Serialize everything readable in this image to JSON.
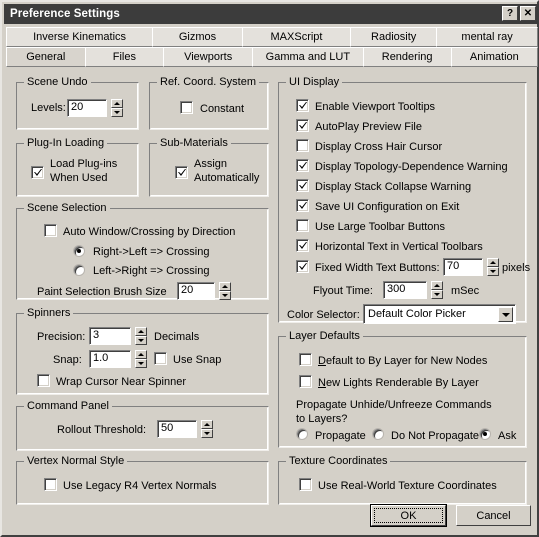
{
  "window": {
    "title": "Preference Settings",
    "help_button": "?",
    "close_button": "✕"
  },
  "tabs": {
    "top_row": [
      {
        "label": "Inverse Kinematics",
        "active": false
      },
      {
        "label": "Gizmos",
        "active": false
      },
      {
        "label": "MAXScript",
        "active": false
      },
      {
        "label": "Radiosity",
        "active": false
      },
      {
        "label": "mental ray",
        "active": false
      }
    ],
    "bottom_row": [
      {
        "label": "General",
        "active": true
      },
      {
        "label": "Files",
        "active": false
      },
      {
        "label": "Viewports",
        "active": false
      },
      {
        "label": "Gamma and LUT",
        "active": false
      },
      {
        "label": "Rendering",
        "active": false
      },
      {
        "label": "Animation",
        "active": false
      }
    ]
  },
  "scene_undo": {
    "title": "Scene Undo",
    "levels_label": "Levels:",
    "levels_value": "20"
  },
  "ref_coord_system": {
    "title": "Ref. Coord. System",
    "constant_label": "Constant",
    "constant_checked": false
  },
  "plugin_loading": {
    "title": "Plug-In Loading",
    "load_label_line1": "Load Plug-ins",
    "load_label_line2": "When Used",
    "load_checked": true
  },
  "sub_materials": {
    "title": "Sub-Materials",
    "assign_label_line1": "Assign",
    "assign_label_line2": "Automatically",
    "assign_checked": true
  },
  "scene_selection": {
    "title": "Scene Selection",
    "auto_window_label": "Auto Window/Crossing by Direction",
    "auto_window_checked": false,
    "radio_right_left": "Right->Left => Crossing",
    "radio_left_right": "Left->Right => Crossing",
    "radio_selected": "right_left",
    "brush_size_label": "Paint Selection Brush Size",
    "brush_size_value": "20"
  },
  "spinners": {
    "title": "Spinners",
    "precision_label": "Precision:",
    "precision_value": "3",
    "decimals_label": "Decimals",
    "snap_label": "Snap:",
    "snap_value": "1.0",
    "use_snap_label": "Use Snap",
    "use_snap_checked": false,
    "wrap_cursor_label": "Wrap Cursor Near Spinner",
    "wrap_cursor_checked": false
  },
  "command_panel": {
    "title": "Command Panel",
    "rollout_label": "Rollout Threshold:",
    "rollout_value": "50"
  },
  "vertex_normal_style": {
    "title": "Vertex Normal Style",
    "legacy_label": "Use Legacy R4 Vertex Normals",
    "legacy_checked": false
  },
  "ui_display": {
    "title": "UI Display",
    "checkboxes": [
      {
        "label": "Enable Viewport Tooltips",
        "checked": true
      },
      {
        "label": "AutoPlay Preview File",
        "checked": true
      },
      {
        "label": "Display Cross Hair Cursor",
        "checked": false
      },
      {
        "label": "Display Topology-Dependence Warning",
        "checked": true
      },
      {
        "label": "Display Stack Collapse Warning",
        "checked": true
      },
      {
        "label": "Save UI Configuration on Exit",
        "checked": true
      },
      {
        "label": "Use Large Toolbar Buttons",
        "checked": false
      },
      {
        "label": "Horizontal Text in Vertical Toolbars",
        "checked": true
      }
    ],
    "fixed_width_label": "Fixed Width Text Buttons:",
    "fixed_width_checked": true,
    "fixed_width_value": "70",
    "pixels_label": "pixels",
    "flyout_label": "Flyout Time:",
    "flyout_value": "300",
    "msec_label": "mSec",
    "color_selector_label": "Color Selector:",
    "color_selector_value": "Default Color Picker"
  },
  "layer_defaults": {
    "title": "Layer Defaults",
    "default_by_layer_label_pre": "",
    "default_by_layer_mnemonic": "D",
    "default_by_layer_label_post": "efault to By Layer for New Nodes",
    "default_by_layer_checked": false,
    "new_lights_mnemonic": "N",
    "new_lights_label_post": "ew Lights Renderable By Layer",
    "new_lights_checked": false,
    "propagate_question_line1": "Propagate Unhide/Unfreeze Commands",
    "propagate_question_line2": "to Layers?",
    "radio_propagate": "Propagate",
    "radio_do_not_propagate": "Do Not Propagate",
    "radio_ask": "Ask",
    "radio_selected": "ask"
  },
  "texture_coordinates": {
    "title": "Texture Coordinates",
    "real_world_label": "Use Real-World Texture Coordinates",
    "real_world_checked": false
  },
  "buttons": {
    "ok_label": "OK",
    "cancel_label": "Cancel"
  },
  "colors": {
    "face": "#d4d0c8",
    "titlebar": "#3c3c3c",
    "field_bg": "#ffffff",
    "shadow": "#808080"
  }
}
